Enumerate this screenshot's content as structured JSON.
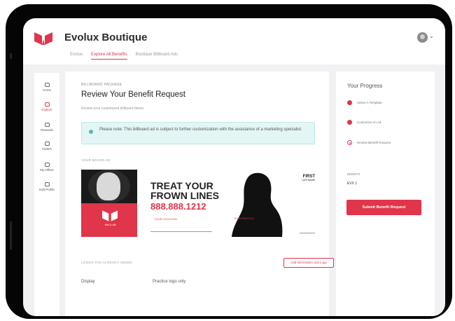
{
  "header": {
    "brand_title": "Evolux Boutique",
    "tabs": [
      {
        "label": "Evolux",
        "active": false
      },
      {
        "label": "Explore All Benefits",
        "active": true
      },
      {
        "label": "Boutique Billboard Ads",
        "active": false
      }
    ]
  },
  "sidebar": {
    "items": [
      {
        "label": "Home",
        "active": false
      },
      {
        "label": "Explore",
        "active": true
      },
      {
        "label": "Rewards",
        "active": false
      },
      {
        "label": "Orders",
        "active": false
      },
      {
        "label": "My Offers",
        "active": false
      },
      {
        "label": "Edit Profile",
        "active": false
      }
    ]
  },
  "main": {
    "eyebrow": "BILLBOARD PACKAGE",
    "title": "Review Your Benefit Request",
    "subtitle": "Review your customized billboard below.",
    "notice": "Please note: This billboard ad is subject to further customization with the assistance of a marketing specialist.",
    "section_ad": "YOUR BOARD AD",
    "billboard": {
      "headline_1": "TREAT YOUR",
      "headline_2": "FROWN LINES",
      "phone": "888.888.1212",
      "location": "YOUR LOCATION",
      "club": "BeCLUB",
      "badge": "YOUR PRACTICE",
      "name_first": "FIRST",
      "name_last": "LASTNAME"
    },
    "section_logos": "LOGOS YOU ALREADY ADDED",
    "add_button": "Add Information and Logo",
    "display_label": "Display",
    "display_value": "Practice logo only"
  },
  "progress": {
    "title": "Your Progress",
    "steps": [
      {
        "label": "Select A Template",
        "state": "done"
      },
      {
        "label": "Customize An Ad",
        "state": "done"
      },
      {
        "label": "Review Benefit Request",
        "state": "current"
      }
    ],
    "benefit_label": "BENEFIT",
    "benefit_value": "EVX 1",
    "submit_label": "Submit Benefit Request"
  },
  "colors": {
    "accent": "#e0354a",
    "notice_bg": "#e3f6f5"
  }
}
